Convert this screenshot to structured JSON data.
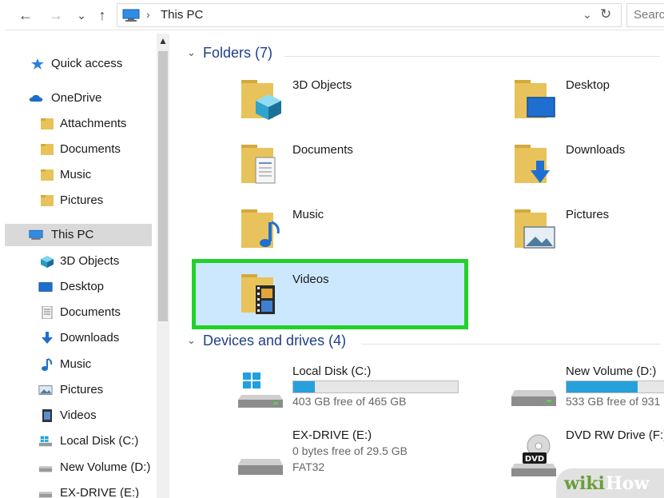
{
  "address_bar": {
    "back": "←",
    "forward": "→",
    "recent": "⌄",
    "up": "↑",
    "path_separator": "›",
    "location": "This PC",
    "dropdown": "⌄",
    "refresh": "↻",
    "search_placeholder": "Search"
  },
  "sidebar": {
    "items": [
      {
        "label": "Quick access",
        "icon": "star-icon"
      },
      {
        "label": "OneDrive",
        "icon": "cloud-icon"
      },
      {
        "label": "Attachments",
        "icon": "folder-icon"
      },
      {
        "label": "Documents",
        "icon": "folder-icon"
      },
      {
        "label": "Music",
        "icon": "folder-icon"
      },
      {
        "label": "Pictures",
        "icon": "folder-icon"
      },
      {
        "label": "This PC",
        "icon": "computer-icon"
      },
      {
        "label": "3D Objects",
        "icon": "cube-icon"
      },
      {
        "label": "Desktop",
        "icon": "desktop-icon"
      },
      {
        "label": "Documents",
        "icon": "document-icon"
      },
      {
        "label": "Downloads",
        "icon": "download-icon"
      },
      {
        "label": "Music",
        "icon": "music-note-icon"
      },
      {
        "label": "Pictures",
        "icon": "picture-icon"
      },
      {
        "label": "Videos",
        "icon": "video-icon"
      },
      {
        "label": "Local Disk (C:)",
        "icon": "windows-drive-icon"
      },
      {
        "label": "New Volume (D:)",
        "icon": "drive-icon"
      },
      {
        "label": "EX-DRIVE (E:)",
        "icon": "drive-icon"
      }
    ],
    "selected": "This PC"
  },
  "main": {
    "folders_header": "Folders (7)",
    "folders": [
      {
        "name": "3D Objects",
        "icon": "3d-objects-folder-icon"
      },
      {
        "name": "Desktop",
        "icon": "desktop-folder-icon"
      },
      {
        "name": "Documents",
        "icon": "documents-folder-icon"
      },
      {
        "name": "Downloads",
        "icon": "downloads-folder-icon"
      },
      {
        "name": "Music",
        "icon": "music-folder-icon"
      },
      {
        "name": "Pictures",
        "icon": "pictures-folder-icon"
      },
      {
        "name": "Videos",
        "icon": "videos-folder-icon",
        "highlighted": true
      }
    ],
    "drives_header": "Devices and drives (4)",
    "drives": [
      {
        "name": "Local Disk (C:)",
        "free_text": "403 GB free of 465 GB",
        "used_fraction": 0.13,
        "icon": "windows-drive-icon"
      },
      {
        "name": "New Volume (D:)",
        "free_text": "533 GB free of 931",
        "used_fraction": 0.43,
        "icon": "drive-icon"
      },
      {
        "name": "EX-DRIVE (E:)",
        "free_text": "0 bytes free of 29.5 GB",
        "filesystem": "FAT32",
        "icon": "drive-icon"
      },
      {
        "name": "DVD RW Drive (F:)",
        "icon": "dvd-drive-icon",
        "dvd_label": "DVD"
      }
    ]
  },
  "watermark": {
    "part1": "wiki",
    "part2": "How"
  },
  "colors": {
    "accent": "#1e3f8a",
    "selection": "#cce8ff",
    "highlight_border": "#22d12a",
    "progress": "#26a0da",
    "folder": "#e8c25a"
  }
}
